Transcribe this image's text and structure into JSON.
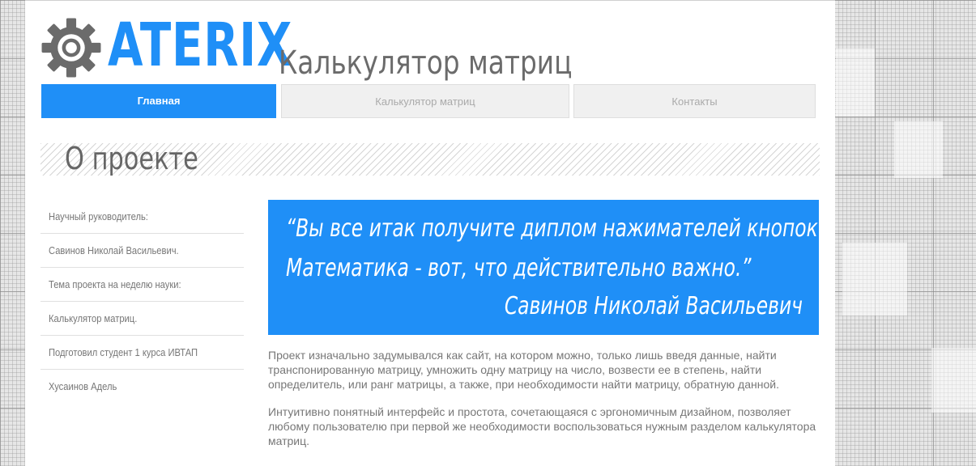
{
  "brand": {
    "logo_text": "ATERIX",
    "site_title": "Калькулятор матриц",
    "accent_color": "#1f8ff7",
    "logo_icon": "gear-icon"
  },
  "nav": [
    {
      "label": "Главная",
      "active": true
    },
    {
      "label": "Калькулятор матриц",
      "active": false
    },
    {
      "label": "Контакты",
      "active": false
    }
  ],
  "section": {
    "title": "О проекте"
  },
  "sidebar": {
    "items": [
      {
        "label": "Научный руководитель:"
      },
      {
        "label": "Савинов Николай Васильевич."
      },
      {
        "label": "Тема проекта на неделю науки:"
      },
      {
        "label": "Калькулятор матриц."
      },
      {
        "label": "Подготовил студент 1 курса ИВТАП"
      },
      {
        "label": "Хусаинов Адель"
      }
    ]
  },
  "quote": {
    "line1": "“Вы все итак получите диплом нажимателей кнопок.",
    "line2": "Математика - вот, что действительно важно.”",
    "author": "Савинов Николай Васильевич"
  },
  "content": {
    "paragraphs": [
      "Проект изначально задумывался как сайт, на котором можно, только лишь введя данные, найти транспонированную матрицу, умножить одну матрицу на число, возвести ее в степень, найти определитель, или ранг матрицы, а также, при необходимости найти матрицу, обратную данной.",
      "Интуитивно понятный интерфейс и простота, сочетающаяся с эргономичным дизайном, позволяет любому пользователю при первой же необходимости воспользоваться нужным разделом калькулятора матриц."
    ]
  }
}
